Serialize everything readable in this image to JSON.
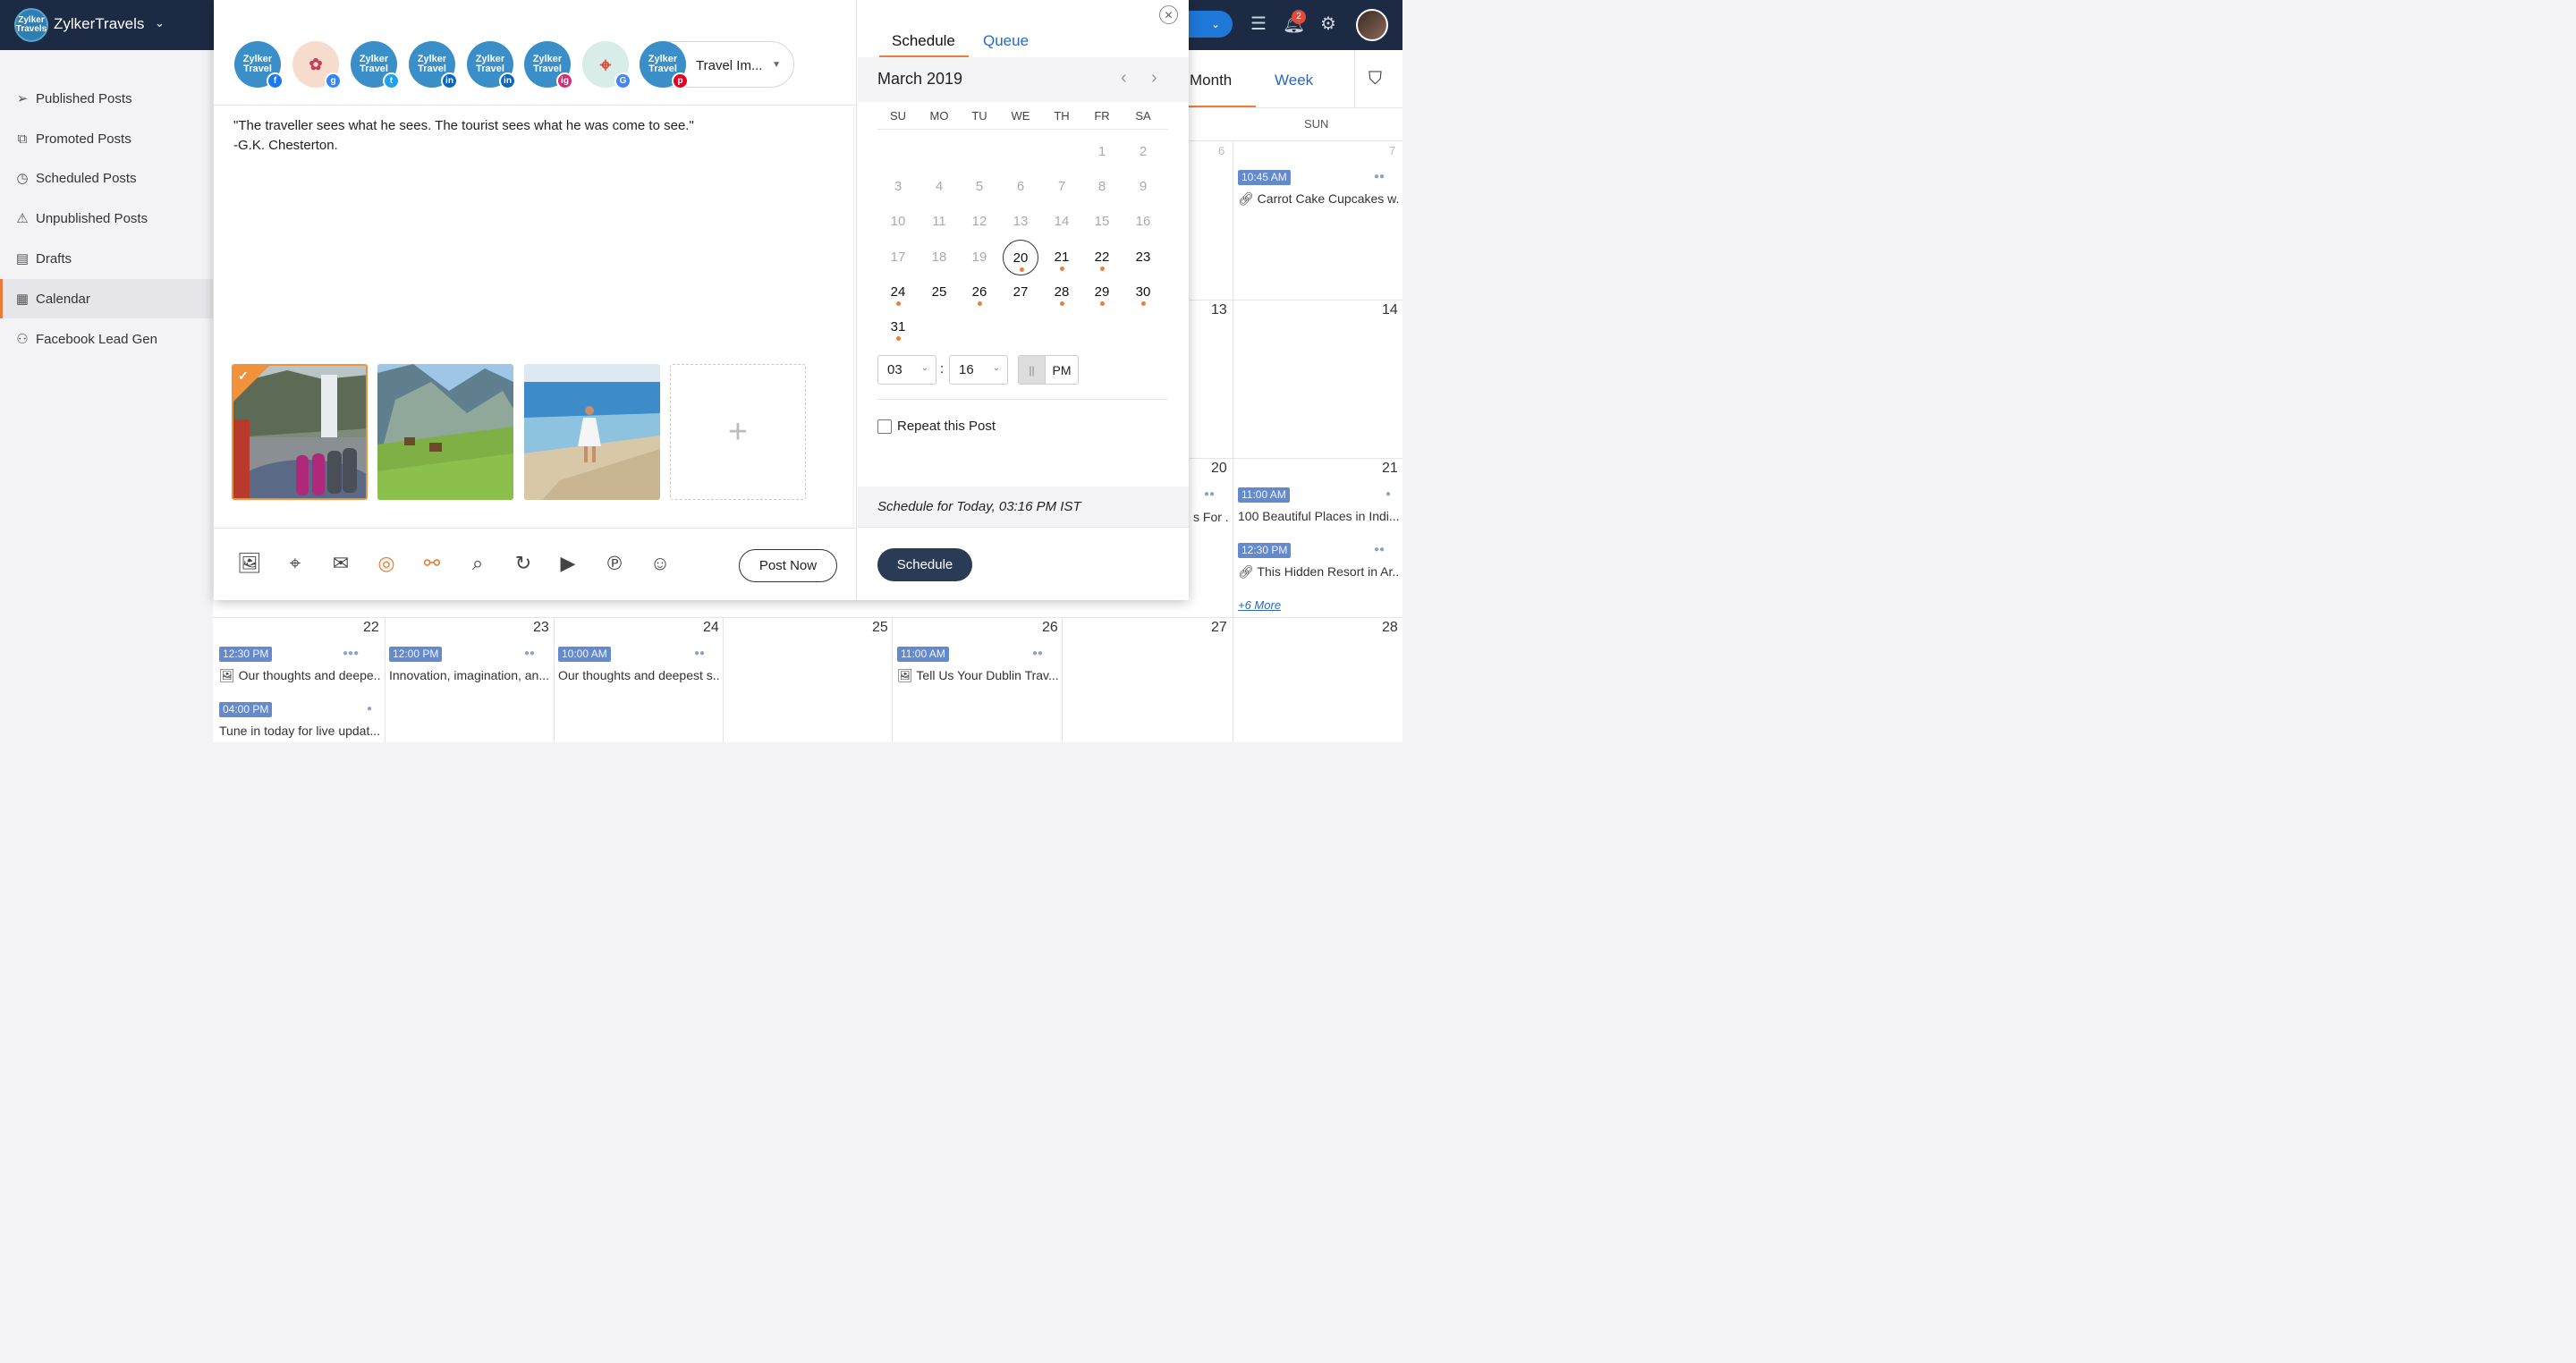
{
  "app": {
    "brand": "ZylkerTravels",
    "logo_text": "Zylker Travels",
    "notifications": "2"
  },
  "sidebar": {
    "items": [
      {
        "label": "Published Posts",
        "icon": "send-icon"
      },
      {
        "label": "Promoted Posts",
        "icon": "promote-icon"
      },
      {
        "label": "Scheduled Posts",
        "icon": "clock-icon"
      },
      {
        "label": "Unpublished Posts",
        "icon": "warning-icon"
      },
      {
        "label": "Drafts",
        "icon": "drafts-icon"
      },
      {
        "label": "Calendar",
        "icon": "calendar-icon"
      },
      {
        "label": "Facebook Lead Gen",
        "icon": "lead-gen-icon"
      }
    ]
  },
  "calendar": {
    "tabs": {
      "month": "Month",
      "week": "Week"
    },
    "day_header": "SUN",
    "nums": {
      "n6": "6",
      "n7": "7",
      "n13": "13",
      "n14": "14",
      "n20": "20",
      "n21": "21",
      "n22": "22",
      "n23": "23",
      "n24": "24",
      "n25": "25",
      "n26": "26",
      "n27": "27",
      "n28": "28"
    },
    "events": {
      "e7_time": "10:45 AM",
      "e7_text": "Carrot Cake Cupcakes w...",
      "e20_text": "s For ...",
      "e21a_time": "11:00 AM",
      "e21a_text": "100 Beautiful Places in Indi...",
      "e21b_time": "12:30 PM",
      "e21b_text": "This Hidden Resort in Ar...",
      "more": "+6 More",
      "e22a_time": "12:30 PM",
      "e22a_text": "Our thoughts and deepe...",
      "e22b_time": "04:00 PM",
      "e22b_text": "Tune in today for live updat...",
      "e23_time": "12:00 PM",
      "e23_text": "Innovation, imagination, an...",
      "e24_time": "10:00 AM",
      "e24_text": "Our thoughts and deepest s...",
      "e26_time": "11:00 AM",
      "e26_text": "Tell Us Your Dublin Trav..."
    }
  },
  "compose": {
    "accounts": [
      {
        "label": "Zylker Travel",
        "network": "facebook",
        "net_glyph": "f",
        "net_color": "#1877f2"
      },
      {
        "label": "",
        "network": "facebook-group",
        "net_glyph": "g",
        "net_color": "#2d88ff"
      },
      {
        "label": "Zylker Travel",
        "network": "twitter",
        "net_glyph": "t",
        "net_color": "#1da1f2"
      },
      {
        "label": "Zylker Travel",
        "network": "linkedin",
        "net_glyph": "in",
        "net_color": "#0a66c2"
      },
      {
        "label": "Zylker Travel",
        "network": "linkedin-page",
        "net_glyph": "in",
        "net_color": "#0a66c2"
      },
      {
        "label": "Zylker Travel",
        "network": "instagram",
        "net_glyph": "ig",
        "net_color": "#d62976"
      },
      {
        "label": "",
        "network": "google-my-business",
        "net_glyph": "G",
        "net_color": "#4285f4"
      },
      {
        "label": "Zylker Travel",
        "network": "pinterest",
        "net_glyph": "p",
        "net_color": "#e60023"
      }
    ],
    "account_select": "Travel Im...",
    "text": "\"The traveller sees what he sees. The tourist sees what he was come to see.\"\n-G.K. Chesterton.",
    "add_media": "+",
    "post_now": "Post Now"
  },
  "schedule": {
    "tabs": {
      "schedule": "Schedule",
      "queue": "Queue"
    },
    "month": "March 2019",
    "weekdays": [
      "SU",
      "MO",
      "TU",
      "WE",
      "TH",
      "FR",
      "SA"
    ],
    "time": {
      "hour": "03",
      "minute": "16",
      "am": "||",
      "pm": "PM"
    },
    "repeat": "Repeat this Post",
    "summary": "Schedule for Today, 03:16 PM  IST",
    "button": "Schedule",
    "accent": "#e8803a"
  }
}
